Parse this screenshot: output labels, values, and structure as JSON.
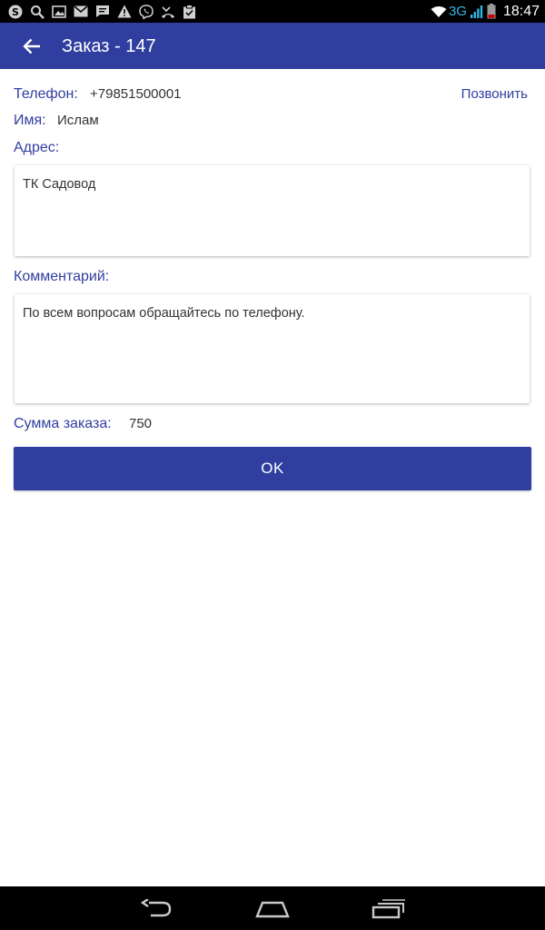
{
  "status_bar": {
    "network_type": "3G",
    "time": "18:47",
    "left_icons": [
      "skype-icon",
      "search-icon",
      "image-icon",
      "mail-icon",
      "message-icon",
      "warning-icon",
      "viber-icon",
      "missed-call-icon",
      "clipboard-icon"
    ],
    "accent_color": "#33b5e5"
  },
  "app_bar": {
    "title": "Заказ - 147",
    "color": "#303f9f"
  },
  "order": {
    "phone_label": "Телефон:",
    "phone_value": "+79851500001",
    "call_label": "Позвонить",
    "name_label": "Имя:",
    "name_value": "Ислам",
    "address_label": "Адрес:",
    "address_value": "ТК Садовод",
    "comment_label": "Комментарий:",
    "comment_value": "По всем вопросам обращайтесь по телефону.",
    "sum_label": "Сумма заказа:",
    "sum_value": "750"
  },
  "actions": {
    "ok_label": "OK"
  },
  "nav_bar": {
    "buttons": [
      "back-nav-icon",
      "home-nav-icon",
      "recent-apps-icon"
    ]
  }
}
